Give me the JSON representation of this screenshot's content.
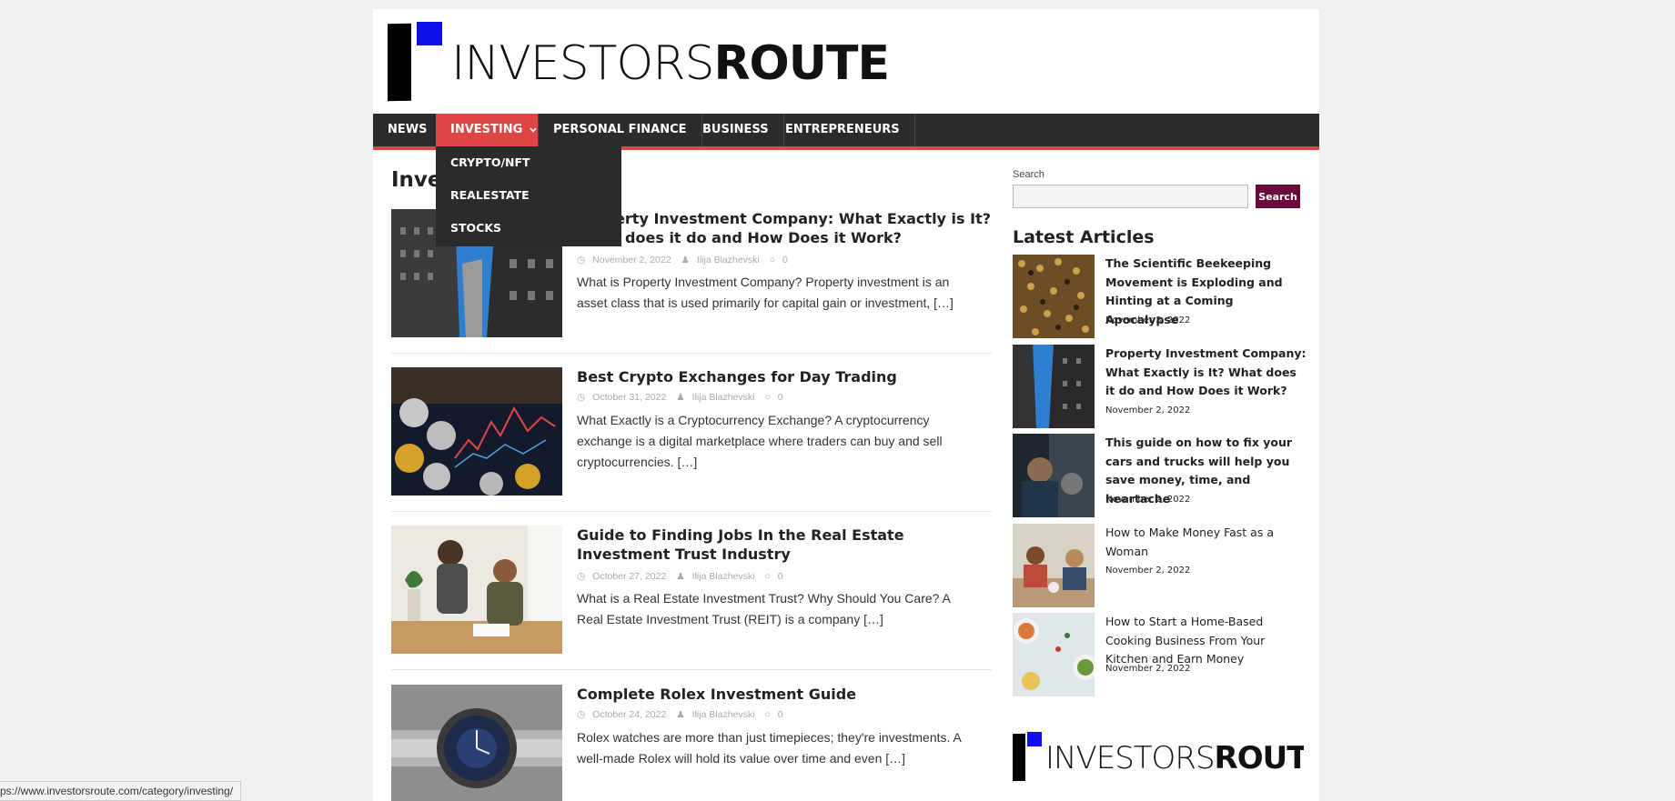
{
  "logo": {
    "light": "INVESTORS",
    "bold": "ROUTE"
  },
  "nav": {
    "items": [
      "NEWS",
      "INVESTING",
      "PERSONAL FINANCE",
      "BUSINESS",
      "ENTREPRENEURS"
    ],
    "active_chevron": "⌄",
    "dropdown": [
      "CRYPTO/NFT",
      "REALESTATE",
      "STOCKS"
    ]
  },
  "main": {
    "category_title": "Investing",
    "posts": [
      {
        "title": "Property Investment Company: What Exactly is It? What does it do and How Does it Work?",
        "date": "November 2, 2022",
        "author": "Ilija Blazhevski",
        "comments": "0",
        "excerpt": "What is Property Investment Company? Property investment is an asset class that is used primarily for capital gain or investment,",
        "more": "[…]"
      },
      {
        "title": "Best Crypto Exchanges for Day Trading",
        "date": "October 31, 2022",
        "author": "Ilija Blazhevski",
        "comments": "0",
        "excerpt": "What Exactly is a Cryptocurrency Exchange? A cryptocurrency exchange is a digital marketplace where traders can buy and sell cryptocurrencies.",
        "more": "[…]"
      },
      {
        "title": "Guide to Finding Jobs In the Real Estate Investment Trust Industry",
        "date": "October 27, 2022",
        "author": "Ilija Blazhevski",
        "comments": "0",
        "excerpt": "What is a Real Estate Investment Trust? Why Should You Care? A Real Estate Investment Trust (REIT) is a company",
        "more": "[…]"
      },
      {
        "title": "Complete Rolex Investment Guide",
        "date": "October 24, 2022",
        "author": "Ilija Blazhevski",
        "comments": "0",
        "excerpt": "Rolex watches are more than just timepieces; they're investments. A well-made Rolex will hold its value over time and even",
        "more": "[…]"
      }
    ]
  },
  "sidebar": {
    "search_label": "Search",
    "search_value": "",
    "search_button": "Search",
    "latest_title": "Latest Articles",
    "articles": [
      {
        "title": "The Scientific Beekeeping Movement is Exploding and Hinting at a Coming Apocalypse",
        "date": "November 3, 2022"
      },
      {
        "title": "Property Investment Company: What Exactly is It? What does it do and How Does it Work?",
        "date": "November 2, 2022"
      },
      {
        "title": "This guide on how to fix your cars and trucks will help you save money, time, and heartache",
        "date": "November 2, 2022"
      },
      {
        "title": "How to Make Money Fast as a Woman",
        "date": "November 2, 2022"
      },
      {
        "title": "How to Start a Home-Based Cooking Business From Your Kitchen and Earn Money",
        "date": "November 2, 2022"
      }
    ]
  },
  "status_url": "ps://www.investorsroute.com/category/investing/",
  "icons": {
    "clock": "clock-icon",
    "user": "user-icon",
    "comment": "comment-icon",
    "chevron": "chevron-down-icon"
  },
  "colors": {
    "accent": "#e04545",
    "nav_bg": "#2b2b2b",
    "search_button": "#6a0a3c",
    "logo_flag": "#1010e8"
  }
}
